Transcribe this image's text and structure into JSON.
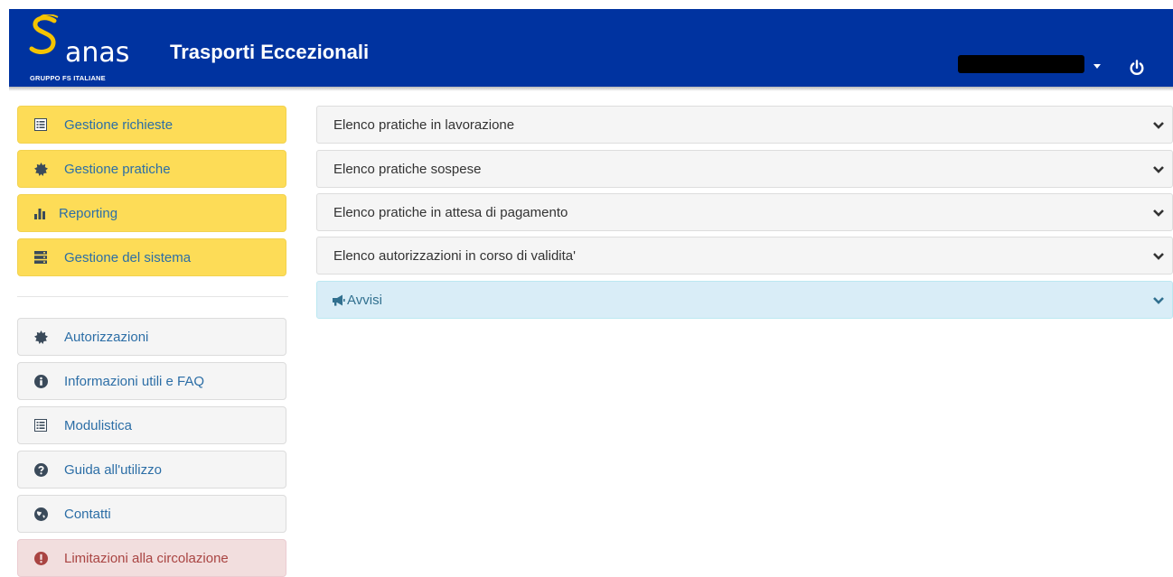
{
  "header": {
    "logo_text": "anas",
    "logo_subtext": "GRUPPO FS ITALIANE",
    "title": "Trasporti Eccezionali",
    "user_name": "",
    "user_menu_icon": "caret-down-icon",
    "power_icon": "power-icon",
    "brand_color": "#0033a0",
    "logo_color": "#f5c400"
  },
  "sidebar": {
    "primary_items": [
      {
        "label": "Gestione richieste",
        "icon": "list-icon"
      },
      {
        "label": "Gestione pratiche",
        "icon": "certificate-icon"
      },
      {
        "label": "Reporting",
        "icon": "bar-chart-icon"
      },
      {
        "label": "Gestione del sistema",
        "icon": "server-icon"
      }
    ],
    "secondary_items": [
      {
        "label": "Autorizzazioni",
        "icon": "certificate-icon"
      },
      {
        "label": "Informazioni utili e FAQ",
        "icon": "info-circle-icon"
      },
      {
        "label": "Modulistica",
        "icon": "list-icon"
      },
      {
        "label": "Guida all'utilizzo",
        "icon": "question-circle-icon"
      },
      {
        "label": "Contatti",
        "icon": "globe-icon"
      },
      {
        "label": "Limitazioni alla circolazione",
        "icon": "exclamation-circle-icon"
      }
    ]
  },
  "main": {
    "panels": [
      {
        "title": "Elenco pratiche in lavorazione"
      },
      {
        "title": "Elenco pratiche sospese"
      },
      {
        "title": "Elenco pratiche in attesa di pagamento"
      },
      {
        "title": "Elenco autorizzazioni in corso di validita'"
      },
      {
        "title": "Avvisi",
        "icon": "bullhorn-icon"
      }
    ]
  }
}
